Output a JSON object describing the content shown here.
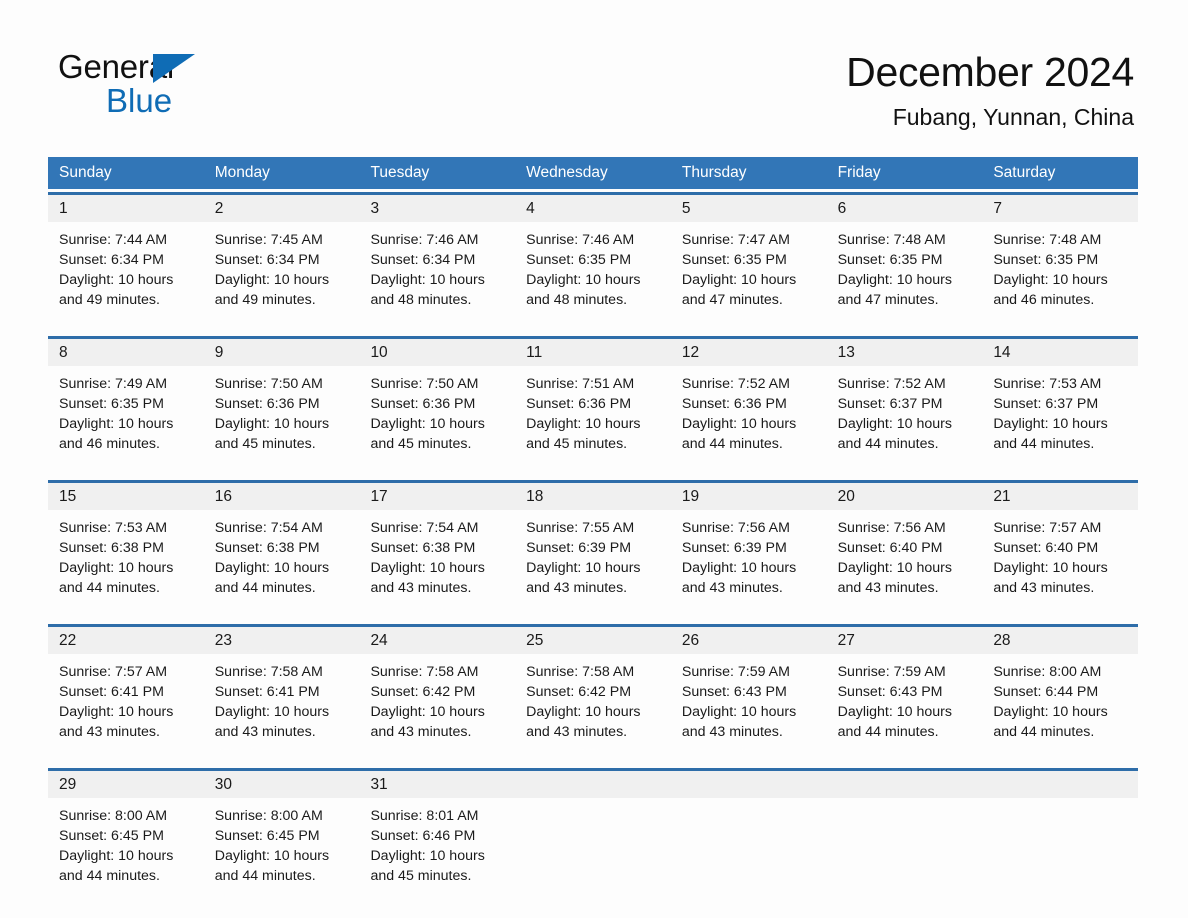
{
  "brand": {
    "name_dark": "General",
    "name_light": "Blue",
    "triangle_color": "#0f6cb5"
  },
  "header": {
    "title": "December 2024",
    "location": "Fubang, Yunnan, China"
  },
  "theme": {
    "header_blue": "#3276b7",
    "row_rule_blue": "#2e6da9",
    "daynum_band_gray": "#f0f0f0",
    "page_background": "#fdfdfd",
    "text_color": "#1a1a1a"
  },
  "calendar": {
    "weekdays": [
      "Sunday",
      "Monday",
      "Tuesday",
      "Wednesday",
      "Thursday",
      "Friday",
      "Saturday"
    ],
    "weeks": [
      {
        "days": [
          {
            "date": "1",
            "sunrise": "Sunrise: 7:44 AM",
            "sunset": "Sunset: 6:34 PM",
            "daylight": "Daylight: 10 hours and 49 minutes."
          },
          {
            "date": "2",
            "sunrise": "Sunrise: 7:45 AM",
            "sunset": "Sunset: 6:34 PM",
            "daylight": "Daylight: 10 hours and 49 minutes."
          },
          {
            "date": "3",
            "sunrise": "Sunrise: 7:46 AM",
            "sunset": "Sunset: 6:34 PM",
            "daylight": "Daylight: 10 hours and 48 minutes."
          },
          {
            "date": "4",
            "sunrise": "Sunrise: 7:46 AM",
            "sunset": "Sunset: 6:35 PM",
            "daylight": "Daylight: 10 hours and 48 minutes."
          },
          {
            "date": "5",
            "sunrise": "Sunrise: 7:47 AM",
            "sunset": "Sunset: 6:35 PM",
            "daylight": "Daylight: 10 hours and 47 minutes."
          },
          {
            "date": "6",
            "sunrise": "Sunrise: 7:48 AM",
            "sunset": "Sunset: 6:35 PM",
            "daylight": "Daylight: 10 hours and 47 minutes."
          },
          {
            "date": "7",
            "sunrise": "Sunrise: 7:48 AM",
            "sunset": "Sunset: 6:35 PM",
            "daylight": "Daylight: 10 hours and 46 minutes."
          }
        ]
      },
      {
        "days": [
          {
            "date": "8",
            "sunrise": "Sunrise: 7:49 AM",
            "sunset": "Sunset: 6:35 PM",
            "daylight": "Daylight: 10 hours and 46 minutes."
          },
          {
            "date": "9",
            "sunrise": "Sunrise: 7:50 AM",
            "sunset": "Sunset: 6:36 PM",
            "daylight": "Daylight: 10 hours and 45 minutes."
          },
          {
            "date": "10",
            "sunrise": "Sunrise: 7:50 AM",
            "sunset": "Sunset: 6:36 PM",
            "daylight": "Daylight: 10 hours and 45 minutes."
          },
          {
            "date": "11",
            "sunrise": "Sunrise: 7:51 AM",
            "sunset": "Sunset: 6:36 PM",
            "daylight": "Daylight: 10 hours and 45 minutes."
          },
          {
            "date": "12",
            "sunrise": "Sunrise: 7:52 AM",
            "sunset": "Sunset: 6:36 PM",
            "daylight": "Daylight: 10 hours and 44 minutes."
          },
          {
            "date": "13",
            "sunrise": "Sunrise: 7:52 AM",
            "sunset": "Sunset: 6:37 PM",
            "daylight": "Daylight: 10 hours and 44 minutes."
          },
          {
            "date": "14",
            "sunrise": "Sunrise: 7:53 AM",
            "sunset": "Sunset: 6:37 PM",
            "daylight": "Daylight: 10 hours and 44 minutes."
          }
        ]
      },
      {
        "days": [
          {
            "date": "15",
            "sunrise": "Sunrise: 7:53 AM",
            "sunset": "Sunset: 6:38 PM",
            "daylight": "Daylight: 10 hours and 44 minutes."
          },
          {
            "date": "16",
            "sunrise": "Sunrise: 7:54 AM",
            "sunset": "Sunset: 6:38 PM",
            "daylight": "Daylight: 10 hours and 44 minutes."
          },
          {
            "date": "17",
            "sunrise": "Sunrise: 7:54 AM",
            "sunset": "Sunset: 6:38 PM",
            "daylight": "Daylight: 10 hours and 43 minutes."
          },
          {
            "date": "18",
            "sunrise": "Sunrise: 7:55 AM",
            "sunset": "Sunset: 6:39 PM",
            "daylight": "Daylight: 10 hours and 43 minutes."
          },
          {
            "date": "19",
            "sunrise": "Sunrise: 7:56 AM",
            "sunset": "Sunset: 6:39 PM",
            "daylight": "Daylight: 10 hours and 43 minutes."
          },
          {
            "date": "20",
            "sunrise": "Sunrise: 7:56 AM",
            "sunset": "Sunset: 6:40 PM",
            "daylight": "Daylight: 10 hours and 43 minutes."
          },
          {
            "date": "21",
            "sunrise": "Sunrise: 7:57 AM",
            "sunset": "Sunset: 6:40 PM",
            "daylight": "Daylight: 10 hours and 43 minutes."
          }
        ]
      },
      {
        "days": [
          {
            "date": "22",
            "sunrise": "Sunrise: 7:57 AM",
            "sunset": "Sunset: 6:41 PM",
            "daylight": "Daylight: 10 hours and 43 minutes."
          },
          {
            "date": "23",
            "sunrise": "Sunrise: 7:58 AM",
            "sunset": "Sunset: 6:41 PM",
            "daylight": "Daylight: 10 hours and 43 minutes."
          },
          {
            "date": "24",
            "sunrise": "Sunrise: 7:58 AM",
            "sunset": "Sunset: 6:42 PM",
            "daylight": "Daylight: 10 hours and 43 minutes."
          },
          {
            "date": "25",
            "sunrise": "Sunrise: 7:58 AM",
            "sunset": "Sunset: 6:42 PM",
            "daylight": "Daylight: 10 hours and 43 minutes."
          },
          {
            "date": "26",
            "sunrise": "Sunrise: 7:59 AM",
            "sunset": "Sunset: 6:43 PM",
            "daylight": "Daylight: 10 hours and 43 minutes."
          },
          {
            "date": "27",
            "sunrise": "Sunrise: 7:59 AM",
            "sunset": "Sunset: 6:43 PM",
            "daylight": "Daylight: 10 hours and 44 minutes."
          },
          {
            "date": "28",
            "sunrise": "Sunrise: 8:00 AM",
            "sunset": "Sunset: 6:44 PM",
            "daylight": "Daylight: 10 hours and 44 minutes."
          }
        ]
      },
      {
        "days": [
          {
            "date": "29",
            "sunrise": "Sunrise: 8:00 AM",
            "sunset": "Sunset: 6:45 PM",
            "daylight": "Daylight: 10 hours and 44 minutes."
          },
          {
            "date": "30",
            "sunrise": "Sunrise: 8:00 AM",
            "sunset": "Sunset: 6:45 PM",
            "daylight": "Daylight: 10 hours and 44 minutes."
          },
          {
            "date": "31",
            "sunrise": "Sunrise: 8:01 AM",
            "sunset": "Sunset: 6:46 PM",
            "daylight": "Daylight: 10 hours and 45 minutes."
          },
          {
            "date": "",
            "sunrise": "",
            "sunset": "",
            "daylight": ""
          },
          {
            "date": "",
            "sunrise": "",
            "sunset": "",
            "daylight": ""
          },
          {
            "date": "",
            "sunrise": "",
            "sunset": "",
            "daylight": ""
          },
          {
            "date": "",
            "sunrise": "",
            "sunset": "",
            "daylight": ""
          }
        ]
      }
    ]
  }
}
